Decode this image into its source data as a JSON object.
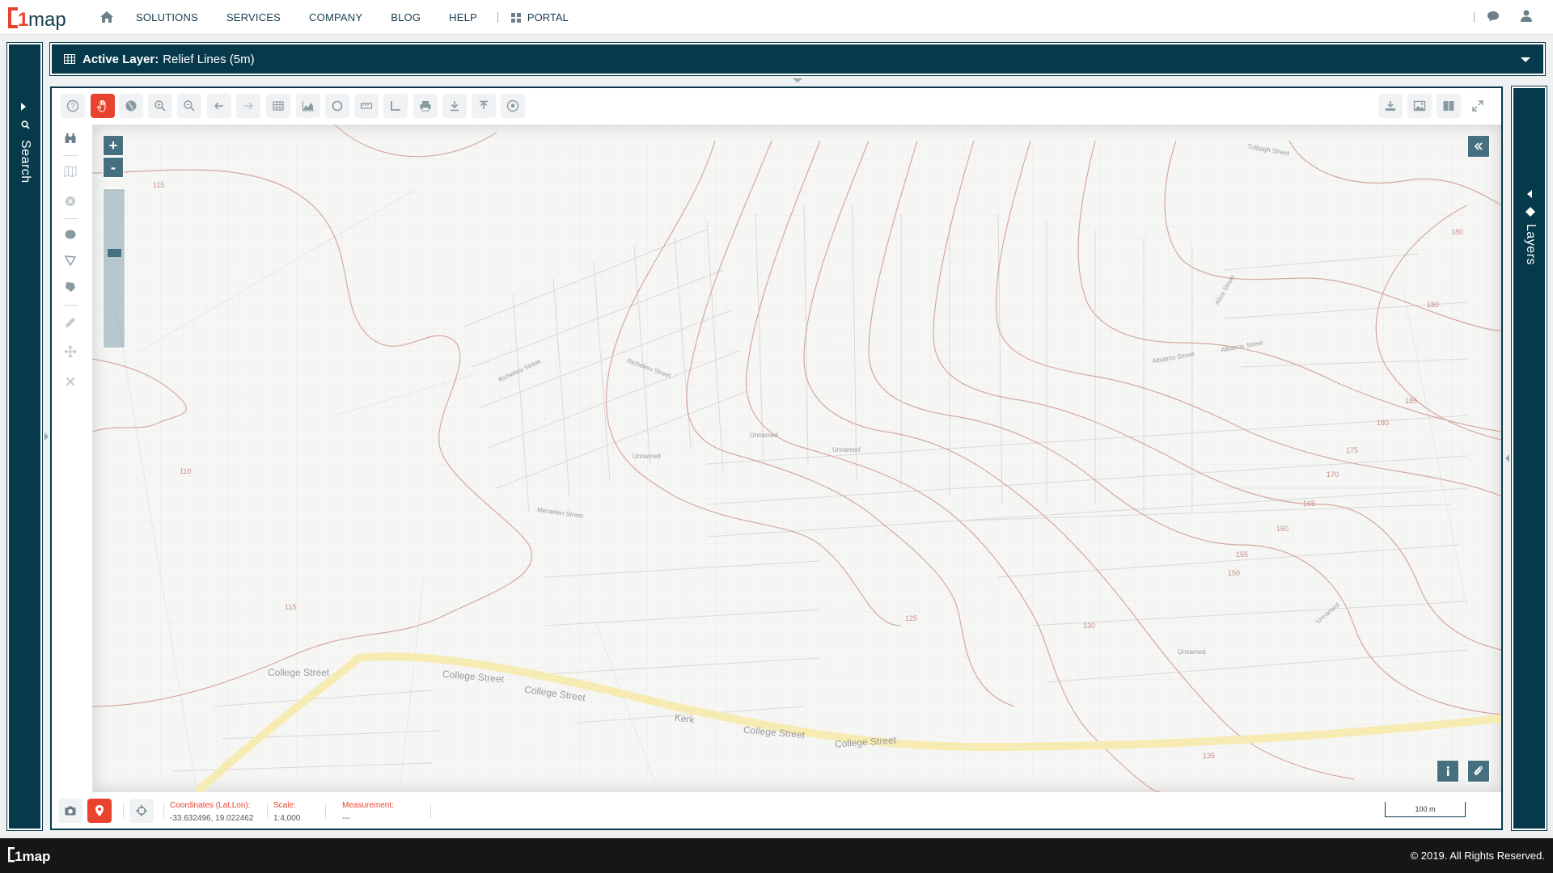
{
  "brand": {
    "name": "1map",
    "accent": "#e8432e",
    "dark": "#063a4b"
  },
  "topnav": {
    "items": [
      "SOLUTIONS",
      "SERVICES",
      "COMPANY",
      "BLOG",
      "HELP"
    ],
    "portal": "PORTAL"
  },
  "left_sidebar": {
    "label": "Search",
    "icon": "search-icon"
  },
  "right_sidebar": {
    "label": "Layers",
    "icon": "layers-icon"
  },
  "layer_bar": {
    "prefix": "Active Layer:",
    "value": "Relief Lines (5m)"
  },
  "toolbar": {
    "left_tools": [
      "help-icon",
      "pan-hand-icon",
      "globe-icon",
      "zoom-in-icon",
      "zoom-out-icon",
      "back-arrow-icon",
      "forward-arrow-icon",
      "table-icon",
      "area-chart-icon",
      "circle-icon",
      "ruler-icon",
      "angle-icon",
      "print-icon",
      "download-icon",
      "upload-icon",
      "soccer-ball-icon"
    ],
    "right_tools": [
      "download-person-icon",
      "image-icon",
      "split-view-icon",
      "fullscreen-icon"
    ]
  },
  "vertical_tools": [
    "binoculars-icon",
    "map-icon",
    "clear-circle-icon",
    "circle-select-icon",
    "polygon-select-icon",
    "polygon-fill-icon",
    "pencil-icon",
    "move-icon",
    "close-icon"
  ],
  "map": {
    "zoom_in": "+",
    "zoom_out": "-",
    "zoom_level_fraction": 0.4,
    "contour_labels": [
      "115",
      "110",
      "115",
      "125",
      "130",
      "135",
      "150",
      "155",
      "160",
      "165",
      "170",
      "175",
      "180",
      "185",
      "180",
      "180"
    ],
    "street_labels": [
      "College Street",
      "College Street",
      "College Street",
      "College Street",
      "College Street",
      "Kerk",
      "Unnamed",
      "Unnamed",
      "Unnamed",
      "Unnamed",
      "Unnamed",
      "Alice Street",
      "Albatros Street",
      "Albatros Street",
      "Richelieu Street",
      "Richelieu Street",
      "Meraelen Street",
      "Tulbagh Street"
    ]
  },
  "status": {
    "coordinates_label": "Coordinates (Lat,Lon):",
    "coordinates_value": "-33.632496, 19.022462",
    "scale_label": "Scale:",
    "scale_value": "1:4,000",
    "measurement_label": "Measurement:",
    "measurement_value": "---",
    "scalebar": "100 m"
  },
  "footer": {
    "logo": "1map",
    "copyright": "© 2019. All Rights Reserved."
  }
}
